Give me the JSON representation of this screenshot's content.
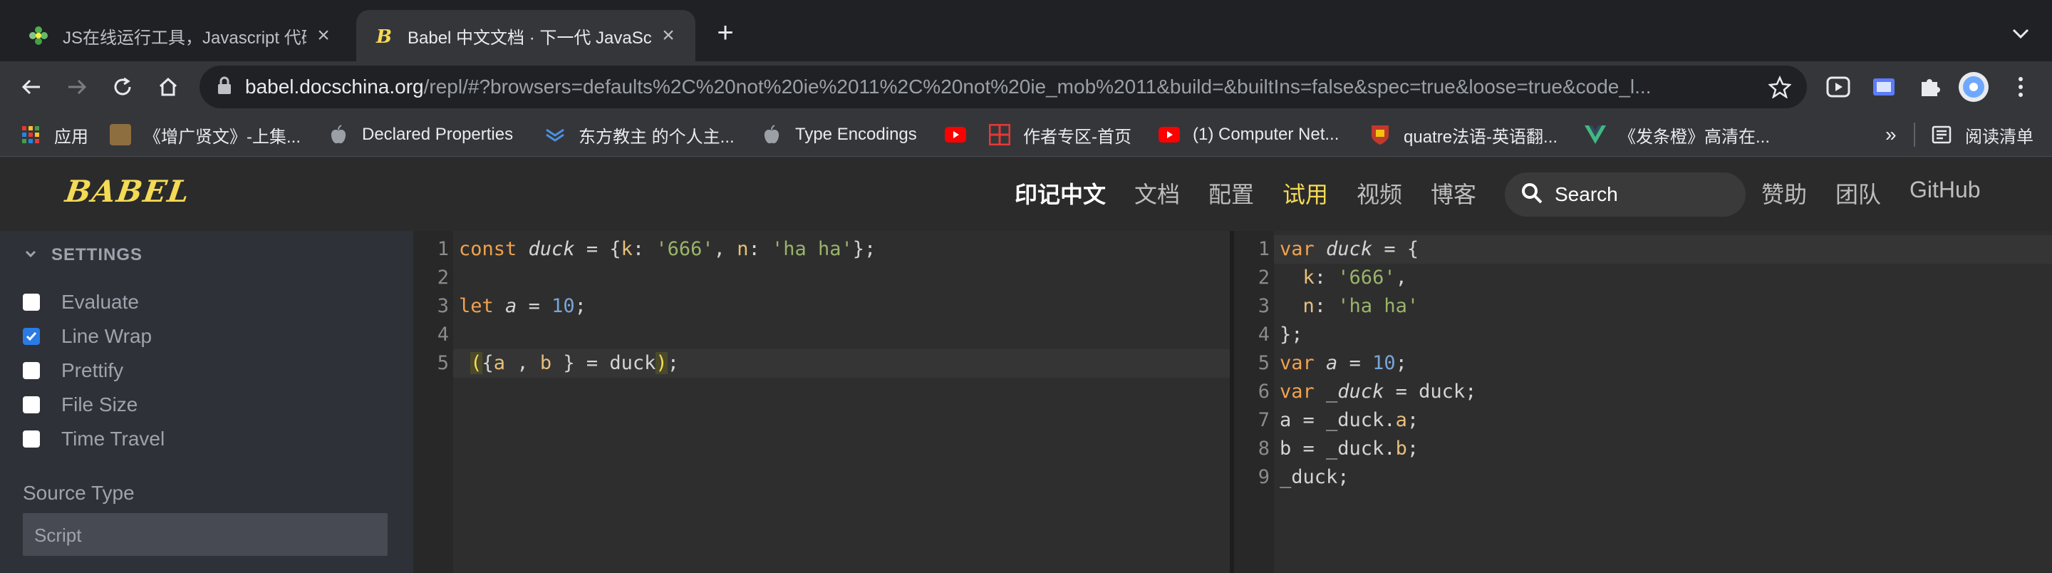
{
  "browser": {
    "tabs": [
      {
        "title": "JS在线运行工具，Javascript 代码",
        "active": false
      },
      {
        "title": "Babel 中文文档 · 下一代 JavaSc",
        "active": true
      }
    ],
    "new_tab": "+",
    "tab_menu": "⌄",
    "url_host": "babel.docschina.org",
    "url_rest": "/repl/#?browsers=defaults%2C%20not%20ie%2011%2C%20not%20ie_mob%2011&build=&builtIns=false&spec=true&loose=true&code_l...",
    "bookmarks": [
      {
        "label": "应用",
        "icon": "apps-grid-icon"
      },
      {
        "label": "《增广贤文》-上集...",
        "icon": "book-icon"
      },
      {
        "label": "Declared Properties",
        "icon": "apple-icon"
      },
      {
        "label": "东方教主 的个人主...",
        "icon": "layers-icon"
      },
      {
        "label": "Type Encodings",
        "icon": "apple-icon"
      },
      {
        "label": "",
        "icon": "youtube-icon"
      },
      {
        "label": "作者专区-首页",
        "icon": "grid-red-icon"
      },
      {
        "label": "(1) Computer Net...",
        "icon": "youtube-icon"
      },
      {
        "label": "quatre法语-英语翻...",
        "icon": "crest-icon"
      },
      {
        "label": "《发条橙》高清在...",
        "icon": "vue-icon"
      }
    ],
    "more_bookmarks": "»",
    "reading_list": "阅读清单"
  },
  "babel": {
    "logo": "BABEL",
    "nav": [
      "印记中文",
      "文档",
      "配置",
      "试用",
      "视频",
      "博客"
    ],
    "search_placeholder": "Search",
    "nav_right": [
      "赞助",
      "团队",
      "GitHub"
    ]
  },
  "sidebar": {
    "section_title": "SETTINGS",
    "options": [
      {
        "label": "Evaluate",
        "checked": false
      },
      {
        "label": "Line Wrap",
        "checked": true
      },
      {
        "label": "Prettify",
        "checked": false
      },
      {
        "label": "File Size",
        "checked": false
      },
      {
        "label": "Time Travel",
        "checked": false
      }
    ],
    "source_type_label": "Source Type",
    "source_type_value": "Script"
  },
  "editor_input": {
    "line_numbers": [
      "1",
      "2",
      "3",
      "4",
      "5"
    ],
    "lines": [
      "const duck = {k: '666', n: 'ha ha'};",
      "",
      "let a = 10;",
      "",
      " ({a , b } = duck);"
    ]
  },
  "editor_output": {
    "line_numbers": [
      "1",
      "2",
      "3",
      "4",
      "5",
      "6",
      "7",
      "8",
      "9"
    ],
    "lines": [
      "var duck = {",
      "  k: '666',",
      "  n: 'ha ha'",
      "};",
      "var a = 10;",
      "var _duck = duck;",
      "a = _duck.a;",
      "b = _duck.b;",
      "_duck;"
    ]
  },
  "colors": {
    "accent_active_nav": "#f5da55",
    "keyword": "#f0a24e",
    "string": "#9ab46a",
    "number": "#79a5d8"
  }
}
